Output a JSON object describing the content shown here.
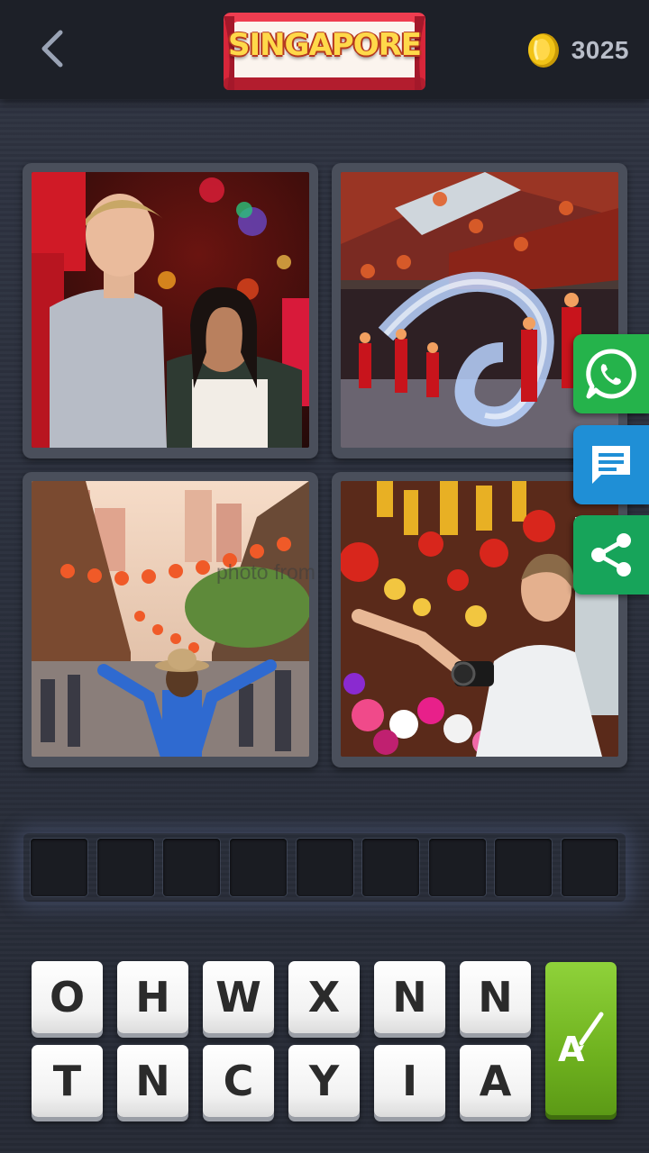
{
  "header": {
    "back_icon": "chevron-left-icon",
    "level_title": "SINGAPORE",
    "coin_icon": "coin-icon",
    "coins": "3025"
  },
  "photos": [
    {
      "subject": "couple-at-lantern-market"
    },
    {
      "subject": "dragon-dance-at-temple"
    },
    {
      "subject": "chinatown-street-with-lanterns"
    },
    {
      "subject": "man-with-camera-at-flower-stall"
    }
  ],
  "watermark": "photo from",
  "social": [
    {
      "icon": "whatsapp-icon",
      "color": "#25b34b"
    },
    {
      "icon": "message-icon",
      "color": "#1f8fd6"
    },
    {
      "icon": "share-icon",
      "color": "#17a45a"
    }
  ],
  "answer": {
    "length": 9
  },
  "keyboard": {
    "row1": [
      "O",
      "H",
      "W",
      "X",
      "N",
      "N"
    ],
    "row2": [
      "T",
      "N",
      "C",
      "Y",
      "I",
      "A"
    ],
    "hint_icon": "paintbrush-hint-icon"
  }
}
